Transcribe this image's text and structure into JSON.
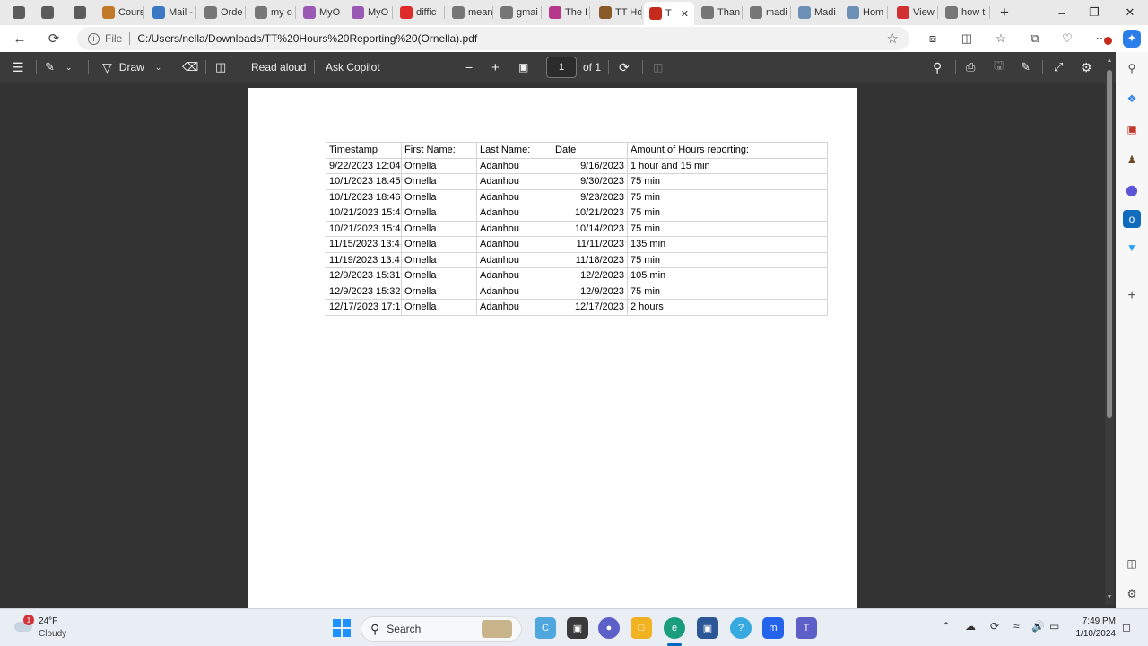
{
  "tabs": [
    {
      "label": "",
      "icon": "profile-icon",
      "color": "#5b5b5b"
    },
    {
      "label": "",
      "icon": "workspaces-icon",
      "color": "#5b5b5b"
    },
    {
      "label": "",
      "icon": "tab-actions-icon",
      "color": "#5b5b5b"
    },
    {
      "label": "Cours",
      "icon": "course-icon",
      "color": "#c07a2a"
    },
    {
      "label": "Mail -",
      "icon": "mail-icon",
      "color": "#3b78c4"
    },
    {
      "label": "Orde",
      "icon": "page-icon",
      "color": "#777777"
    },
    {
      "label": "my o",
      "icon": "search-icon",
      "color": "#777777"
    },
    {
      "label": "MyO",
      "icon": "gmail-icon",
      "color": "#9b59b6"
    },
    {
      "label": "MyO",
      "icon": "gmail-icon",
      "color": "#9b59b6"
    },
    {
      "label": "diffic",
      "icon": "youtube-icon",
      "color": "#e02b2b"
    },
    {
      "label": "mean",
      "icon": "search-icon",
      "color": "#777777"
    },
    {
      "label": "gmai",
      "icon": "search-icon",
      "color": "#777777"
    },
    {
      "label": "The I",
      "icon": "gmail-icon",
      "color": "#b5388c"
    },
    {
      "label": "TT Ho",
      "icon": "ttb-icon",
      "color": "#8a5a2b"
    },
    {
      "label": "T",
      "icon": "pdf-icon",
      "color": "#c42b1c"
    },
    {
      "label": "Than",
      "icon": "page-icon",
      "color": "#777777"
    },
    {
      "label": "madi",
      "icon": "search-icon",
      "color": "#777777"
    },
    {
      "label": "Madi",
      "icon": "feather-icon",
      "color": "#6b8fb5"
    },
    {
      "label": "Hom",
      "icon": "feather-icon",
      "color": "#6b8fb5"
    },
    {
      "label": "View",
      "icon": "view-icon",
      "color": "#d03030"
    },
    {
      "label": "how t",
      "icon": "search-icon",
      "color": "#777777"
    }
  ],
  "address": {
    "file_label": "File",
    "url": "C:/Users/nella/Downloads/TT%20Hours%20Reporting%20(Ornella).pdf"
  },
  "toolbar": {
    "draw": "Draw",
    "read_aloud": "Read aloud",
    "ask_copilot": "Ask Copilot",
    "page": "1",
    "of": "of 1"
  },
  "table": {
    "header": [
      "Timestamp",
      "First Name:",
      "Last Name:",
      "Date",
      "Amount of Hours reporting:",
      ""
    ],
    "rows": [
      [
        "9/22/2023 12:04",
        "Ornella",
        "Adanhou",
        "9/16/2023",
        "1 hour and 15 min",
        ""
      ],
      [
        "10/1/2023 18:45",
        "Ornella",
        "Adanhou",
        "9/30/2023",
        "75 min",
        ""
      ],
      [
        "10/1/2023 18:46",
        "Ornella",
        "Adanhou",
        "9/23/2023",
        "75 min",
        ""
      ],
      [
        "10/21/2023 15:4",
        "Ornella",
        "Adanhou",
        "10/21/2023",
        "75 min",
        ""
      ],
      [
        "10/21/2023 15:4",
        "Ornella",
        "Adanhou",
        "10/14/2023",
        "75 min",
        ""
      ],
      [
        "11/15/2023 13:4",
        "Ornella",
        "Adanhou",
        "11/11/2023",
        "135 min",
        ""
      ],
      [
        "11/19/2023 13:4",
        "Ornella",
        "Adanhou",
        "11/18/2023",
        "75 min",
        ""
      ],
      [
        "12/9/2023 15:31",
        "Ornella",
        "Adanhou",
        "12/2/2023",
        "105 min",
        ""
      ],
      [
        "12/9/2023 15:32",
        "Ornella",
        "Adanhou",
        "12/9/2023",
        "75 min",
        ""
      ],
      [
        "12/17/2023 17:1",
        "Ornella",
        "Adanhou",
        "12/17/2023",
        "2 hours",
        ""
      ]
    ]
  },
  "taskbar": {
    "weather_temp": "24°F",
    "weather_desc": "Cloudy",
    "weather_badge": "1",
    "search_label": "Search",
    "time": "7:49 PM",
    "date": "1/10/2024"
  }
}
